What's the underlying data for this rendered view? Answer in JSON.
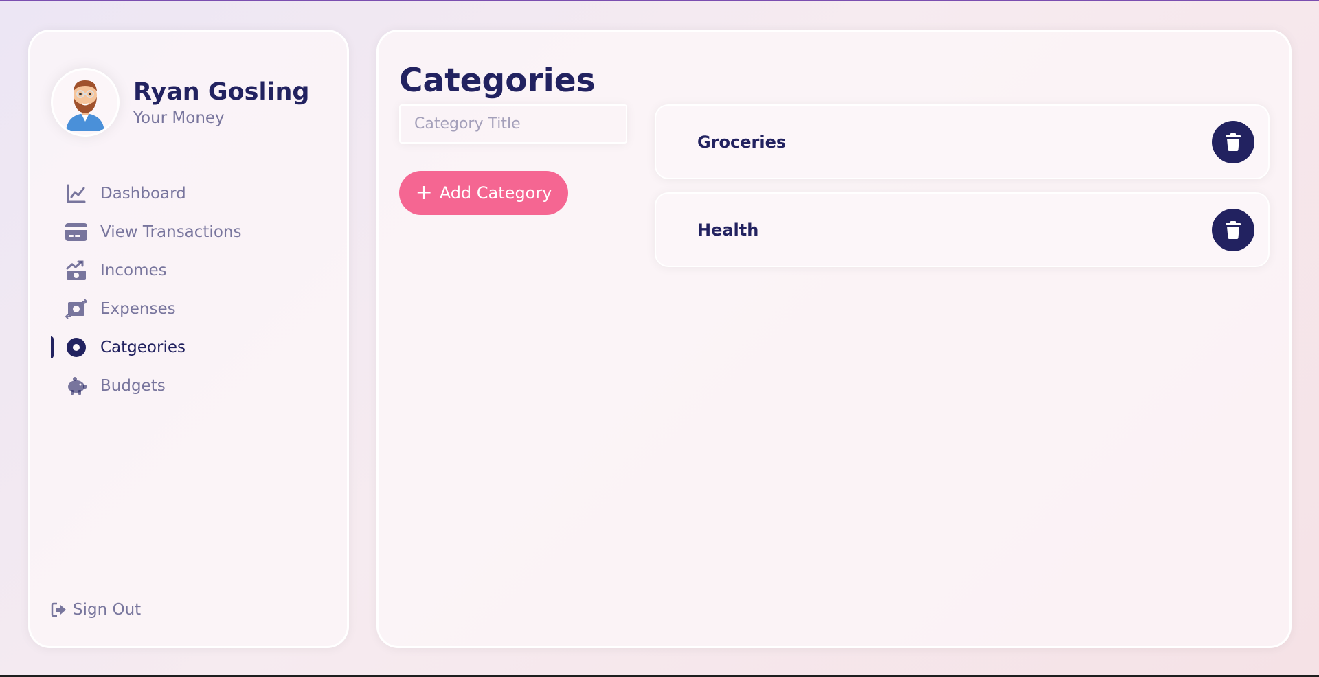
{
  "colors": {
    "primary": "#222260",
    "accent": "#F56692",
    "panel": "#FCF6F9",
    "window_top_border": "#7B4FB0"
  },
  "user": {
    "name": "Ryan Gosling",
    "subtitle": "Your Money",
    "avatar_icon": "bearded-man-avatar"
  },
  "sidebar": {
    "items": [
      {
        "label": "Dashboard",
        "icon": "line-chart-icon",
        "active": false
      },
      {
        "label": "View Transactions",
        "icon": "credit-card-icon",
        "active": false
      },
      {
        "label": "Incomes",
        "icon": "money-bill-trend-up-icon",
        "active": false
      },
      {
        "label": "Expenses",
        "icon": "money-bill-transfer-icon",
        "active": false
      },
      {
        "label": "Catgeories",
        "icon": "circle-dot-icon",
        "active": true
      },
      {
        "label": "Budgets",
        "icon": "piggy-bank-icon",
        "active": false
      }
    ],
    "signout_label": "Sign Out"
  },
  "main": {
    "title": "Categories",
    "input_placeholder": "Category Title",
    "input_value": "",
    "add_button_label": "Add Category",
    "categories": [
      {
        "name": "Groceries"
      },
      {
        "name": "Health"
      }
    ]
  }
}
